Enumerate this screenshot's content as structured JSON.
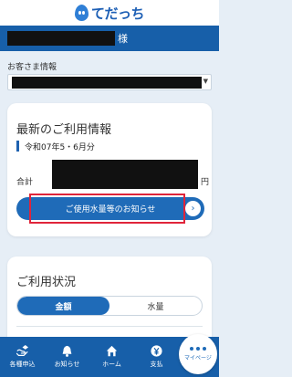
{
  "header": {
    "logo_text": "てだっち",
    "logo_icon": "water-drop-icon"
  },
  "user": {
    "name_suffix": "様"
  },
  "customer": {
    "label": "お客さま情報"
  },
  "usage": {
    "title": "最新のご利用情報",
    "period": "令和07年5・6月分",
    "total_label": "合計",
    "currency": "円",
    "notice_button": "ご使用水量等のお知らせ"
  },
  "status": {
    "title": "ご利用状況",
    "tab_amount": "金額",
    "tab_volume": "水量"
  },
  "nav": {
    "items": [
      {
        "label": "各種申込",
        "icon": "application-icon"
      },
      {
        "label": "お知らせ",
        "icon": "bell-icon"
      },
      {
        "label": "ホーム",
        "icon": "home-icon"
      },
      {
        "label": "支払",
        "icon": "yen-icon"
      }
    ],
    "mypage_label": "マイページ"
  },
  "colors": {
    "primary": "#175fa9",
    "button": "#1f6bb8",
    "highlight": "#e0243a",
    "background": "#e6eef6"
  }
}
